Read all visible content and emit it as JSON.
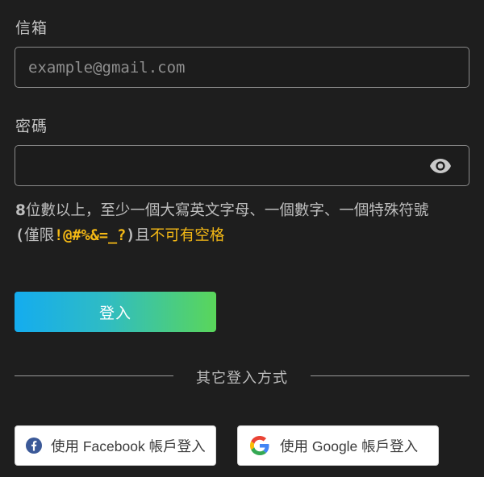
{
  "email": {
    "label": "信箱",
    "placeholder": "example@gmail.com",
    "value": ""
  },
  "password": {
    "label": "密碼",
    "value": "",
    "toggle_icon": "eye-icon"
  },
  "hint": {
    "part1": "8",
    "part2": "位數以上，至少一個大寫英文字母、一個數字、一個特殊符號",
    "paren_open": "(",
    "part3": "僅限",
    "symbols": "!@#%&=_?",
    "paren_close": ")",
    "part4": "且",
    "warning": "不可有空格",
    "warning_color": "#f5b915"
  },
  "login_button": {
    "label": "登入",
    "gradient_start": "#14acef",
    "gradient_end": "#5ad65a"
  },
  "divider": {
    "text": "其它登入方式"
  },
  "social": {
    "facebook": {
      "label": "使用 Facebook 帳戶登入",
      "icon": "facebook-icon",
      "color": "#3b5998"
    },
    "google": {
      "label": "使用 Google 帳戶登入",
      "icon": "google-icon"
    }
  }
}
